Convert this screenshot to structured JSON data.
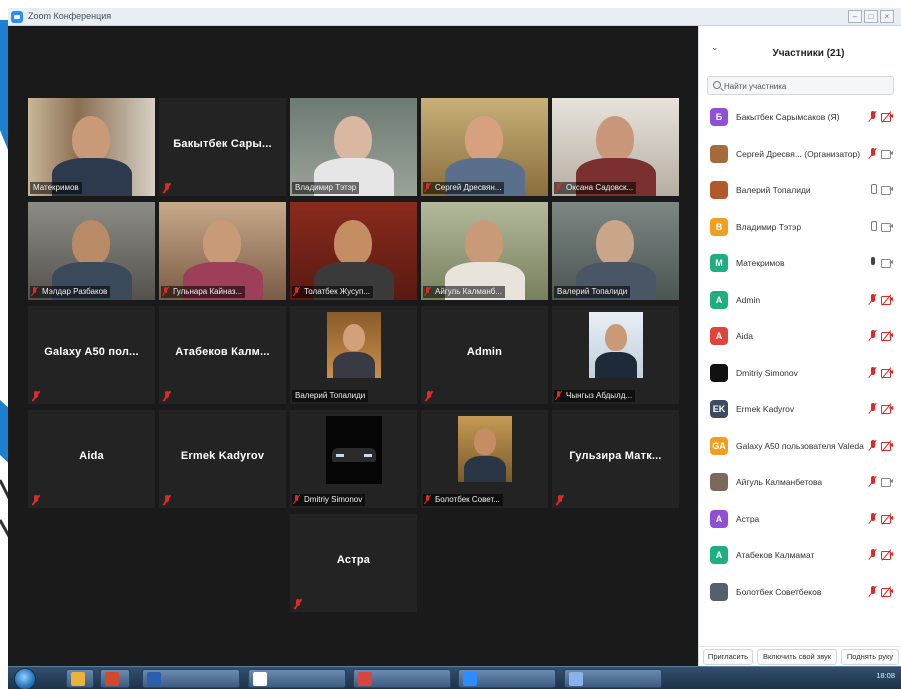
{
  "window": {
    "title": "Zoom Конференция"
  },
  "tiles": [
    {
      "name": "Матекримов",
      "display": "video",
      "muted": false
    },
    {
      "name": "Бакытбек  Сары...",
      "display": "name",
      "muted": true
    },
    {
      "name": "Владимир Тэтэр",
      "display": "video",
      "muted": false
    },
    {
      "name": "Сергей Дресвян...",
      "display": "video",
      "muted": true
    },
    {
      "name": "Оксана Садовск...",
      "display": "video",
      "muted": true
    },
    {
      "name": "Мэлдар Разбаков",
      "display": "video",
      "muted": true
    },
    {
      "name": "Гульнара Кайназ...",
      "display": "video",
      "muted": true
    },
    {
      "name": "Толатбек Жусуп...",
      "display": "video",
      "muted": true
    },
    {
      "name": "Айгуль Калманб...",
      "display": "video",
      "muted": true
    },
    {
      "name": "Валерий Топалиди",
      "display": "video",
      "muted": false
    },
    {
      "name": "Galaxy A50 пол...",
      "display": "name",
      "muted": true
    },
    {
      "name": "Атабеков  Калм...",
      "display": "name",
      "muted": true
    },
    {
      "name": "Валерий Топалиди",
      "display": "avatar",
      "muted": false
    },
    {
      "name": "Admin",
      "display": "name",
      "muted": true
    },
    {
      "name": "Чынгыз Абдылд...",
      "display": "avatar",
      "muted": true
    },
    {
      "name": "Aida",
      "display": "name",
      "muted": true
    },
    {
      "name": "Ermek Kadyrov",
      "display": "name",
      "muted": true
    },
    {
      "name": "Dmitriy Simonov",
      "display": "avatar",
      "muted": true
    },
    {
      "name": "Болотбек Совет...",
      "display": "avatar",
      "muted": true
    },
    {
      "name": "Гульзира  Матк...",
      "display": "name",
      "muted": true
    },
    {
      "name": "Астра",
      "display": "name",
      "muted": true
    }
  ],
  "panel": {
    "title": "Участники (21)",
    "search_placeholder": "Найти участника",
    "participants": [
      {
        "avatar": "Б",
        "color": "#8f4fd6",
        "name": "Бакытбек Сарымсаков (Я)",
        "mic": "muted",
        "cam": "off"
      },
      {
        "avatar": "",
        "color": "#a46b3d",
        "name": "Сергей Дресвя...   (Организатор)",
        "mic": "muted",
        "cam": "on"
      },
      {
        "avatar": "",
        "color": "#b05a2c",
        "name": "Валерий Топалиди",
        "mic": "on",
        "cam": "on"
      },
      {
        "avatar": "В",
        "color": "#f0a020",
        "name": "Владимир Тэтэр",
        "mic": "on",
        "cam": "on"
      },
      {
        "avatar": "M",
        "color": "#1fae82",
        "name": "Матекримов",
        "mic": "active",
        "cam": "on"
      },
      {
        "avatar": "A",
        "color": "#1fae82",
        "name": "Admin",
        "mic": "muted",
        "cam": "off"
      },
      {
        "avatar": "A",
        "color": "#e0443a",
        "name": "Aida",
        "mic": "muted",
        "cam": "off"
      },
      {
        "avatar": "",
        "color": "#111111",
        "name": "Dmitriy Simonov",
        "mic": "muted",
        "cam": "off"
      },
      {
        "avatar": "EK",
        "color": "#3d4a62",
        "name": "Ermek Kadyrov",
        "mic": "muted",
        "cam": "off"
      },
      {
        "avatar": "GA",
        "color": "#f0a020",
        "name": "Galaxy A50 пользователя Valeda",
        "mic": "muted",
        "cam": "off"
      },
      {
        "avatar": "",
        "color": "#7a6a5c",
        "name": "Айгуль Калманбетова",
        "mic": "muted",
        "cam": "on"
      },
      {
        "avatar": "A",
        "color": "#8f4fd6",
        "name": "Астра",
        "mic": "muted",
        "cam": "off"
      },
      {
        "avatar": "A",
        "color": "#1fae82",
        "name": "Атабеков Калмамат",
        "mic": "muted",
        "cam": "off"
      },
      {
        "avatar": "",
        "color": "#55606e",
        "name": "Болотбек Советбеков",
        "mic": "muted",
        "cam": "off"
      }
    ],
    "buttons": {
      "invite": "Пригласить",
      "unmute": "Включить свой звук",
      "raise_hand": "Поднять руку"
    }
  },
  "taskbar": {
    "items": [
      {
        "label": "",
        "color": "#e9b23b"
      },
      {
        "label": "",
        "color": "#d04a2a"
      },
      {
        "label": "",
        "color": "#2b5fae"
      },
      {
        "label": "",
        "color": "#ffffff"
      },
      {
        "label": "",
        "color": "#d64541"
      },
      {
        "label": "",
        "color": "#2d8cff"
      },
      {
        "label": "",
        "color": "#8ab4e8"
      }
    ],
    "clock": "18:08"
  }
}
